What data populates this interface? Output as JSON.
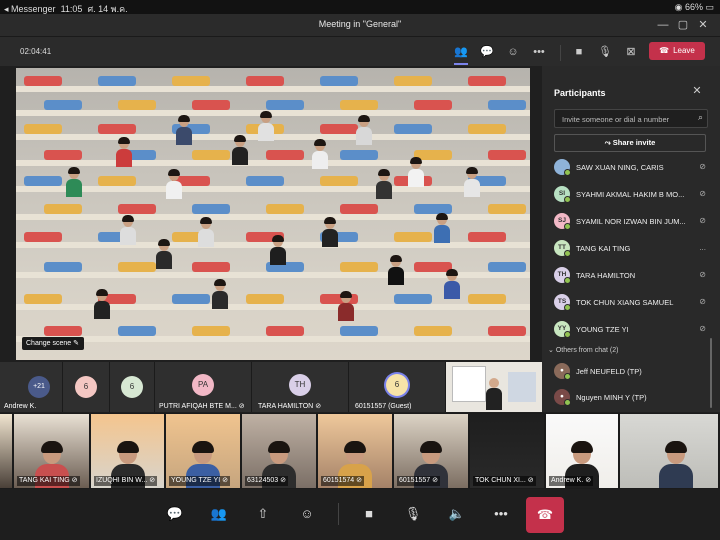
{
  "status_bar": {
    "app": "Messenger",
    "time": "11:05",
    "date": "ศ. 14 พ.ค.",
    "battery": "66%"
  },
  "window": {
    "title": "Meeting in \"General\""
  },
  "toolbar": {
    "timer": "02:04:41",
    "leave_label": "Leave"
  },
  "stage": {
    "change_scene_label": "Change scene"
  },
  "participants_panel": {
    "title": "Participants",
    "invite_placeholder": "Invite someone or dial a number",
    "share_invite_label": "Share invite",
    "participants": [
      {
        "name": "SAW XUAN NING, CARIS",
        "initials": "",
        "color": "#8fb3d9",
        "muted": true
      },
      {
        "name": "SYAHMI AKMAL HAKIM B MO...",
        "initials": "SI",
        "color": "#b7e0c2",
        "muted": true
      },
      {
        "name": "SYAMIL NOR IZWAN BIN JUM...",
        "initials": "SJ",
        "color": "#f2b8c6",
        "muted": true
      },
      {
        "name": "TANG KAI TING",
        "initials": "TT",
        "color": "#c8e6c0",
        "muted": false,
        "more": "..."
      },
      {
        "name": "TARA HAMILTON",
        "initials": "TH",
        "color": "#d9cfe8",
        "muted": true
      },
      {
        "name": "TOK CHUN XIANG SAMUEL",
        "initials": "TS",
        "color": "#d9cfe8",
        "muted": true
      },
      {
        "name": "YOUNG TZE YI",
        "initials": "YY",
        "color": "#c8e6c0",
        "muted": true
      }
    ],
    "others_label": "Others from chat (2)",
    "others": [
      {
        "name": "Jeff NEUFELD (TP)"
      },
      {
        "name": "Nguyen MINH Y (TP)"
      }
    ]
  },
  "strip_top": {
    "tiles": [
      {
        "label": "Andrew K.",
        "badge": "+21"
      },
      {
        "badge": "6",
        "color": "#f4c7c3"
      },
      {
        "badge": "6",
        "color": "#d7e8d3"
      },
      {
        "label": "PUTRI AFIQAH BTE M...",
        "badge": "PA",
        "color": "#f2b8c6"
      },
      {
        "label": "TARA HAMILTON",
        "badge": "TH",
        "color": "#d9cfe8"
      },
      {
        "label": "60151557 (Guest)",
        "badge": "6",
        "color": "#f7e3a8"
      },
      {
        "label": ""
      }
    ]
  },
  "strip_videos": [
    {
      "label": ""
    },
    {
      "label": "TANG KAI TING"
    },
    {
      "label": "IZUQHI BIN W..."
    },
    {
      "label": "YOUNG TZE YI"
    },
    {
      "label": "63124503"
    },
    {
      "label": "60151574"
    },
    {
      "label": "60151557"
    },
    {
      "label": "TOK CHUN XI..."
    },
    {
      "label": "Andrew K."
    },
    {
      "label": ""
    }
  ],
  "colors": {
    "leave": "#c4314b",
    "accent": "#7b83eb",
    "presence": "#92c353"
  },
  "icons": [
    "chat-icon",
    "people-icon",
    "share-screen-icon",
    "reactions-icon",
    "camera-icon",
    "mic-off-icon",
    "speaker-icon",
    "more-icon",
    "hang-up-icon"
  ]
}
